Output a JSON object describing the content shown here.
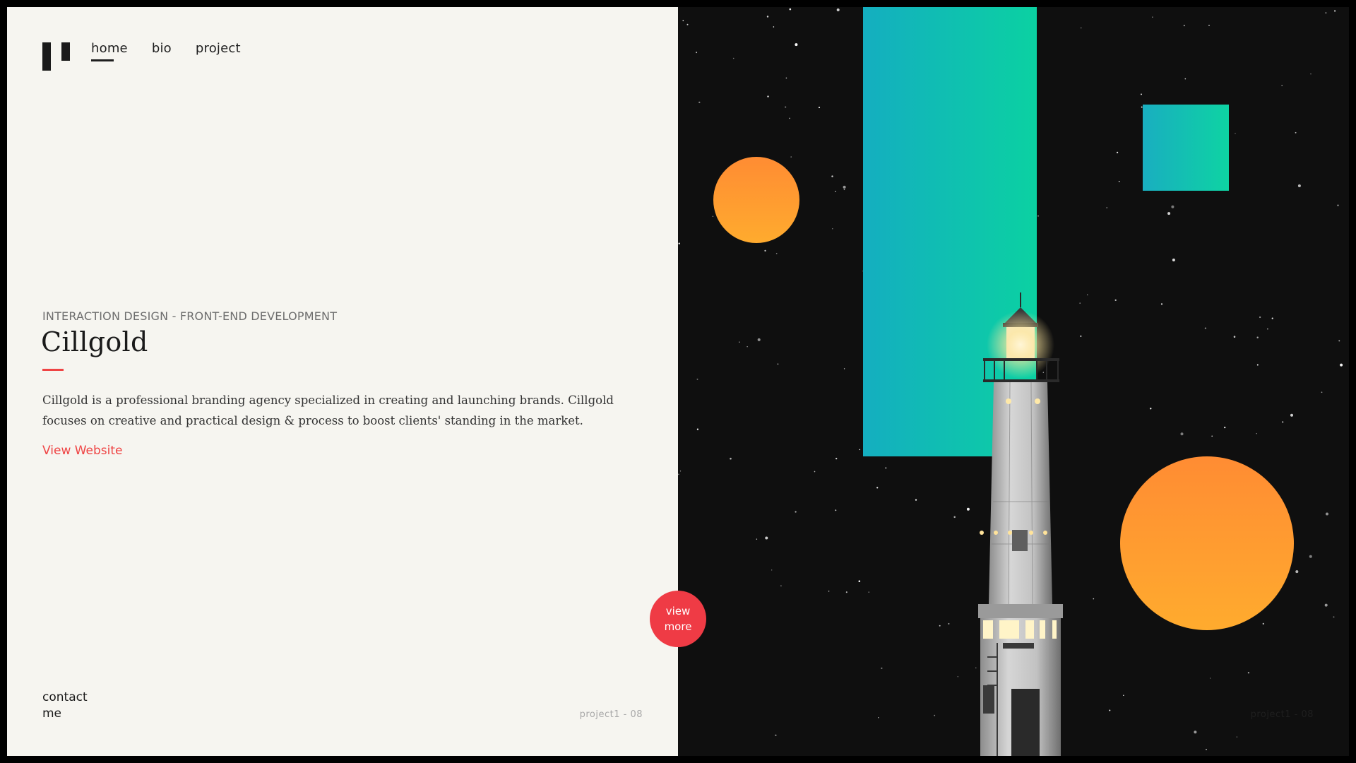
{
  "nav": {
    "items": [
      {
        "label": "home",
        "active": true
      },
      {
        "label": "bio",
        "active": false
      },
      {
        "label": "project",
        "active": false
      }
    ]
  },
  "project": {
    "eyebrow": "INTERACTION DESIGN - FRONT-END DEVELOPMENT",
    "title": "Cillgold",
    "description": "Cillgold is a professional branding agency specialized in creating and launching brands. Cillgold focuses on creative and practical design & process to boost clients' standing in the market.",
    "link_label": "View Website"
  },
  "view_more": {
    "label": "view more"
  },
  "footer": {
    "contact_label": "contact me",
    "counter": "project1 - 08"
  },
  "colors": {
    "accent": "#ef4444",
    "teal_start": "#14aec0",
    "teal_end": "#0bd1a2",
    "orange_start": "#ff8c33",
    "orange_end": "#ffab2e",
    "panel_light": "#f6f5f0",
    "panel_dark": "#0f0f0f"
  },
  "icons": {
    "logo": "logo-mark"
  }
}
